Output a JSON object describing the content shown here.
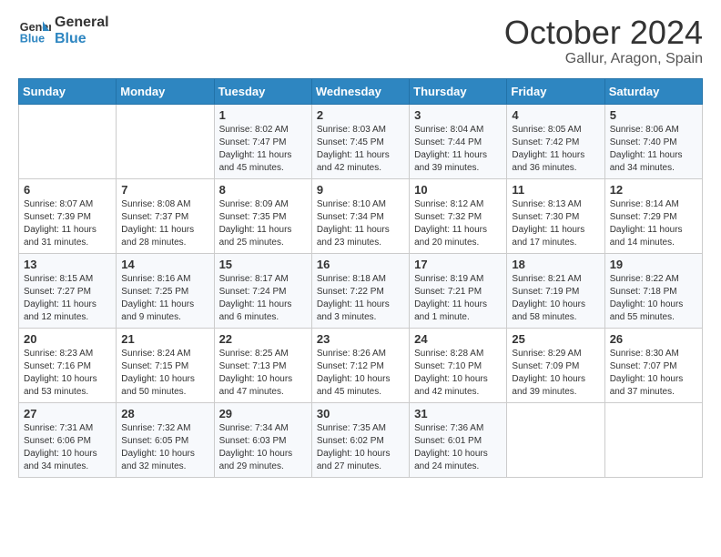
{
  "header": {
    "logo_line1": "General",
    "logo_line2": "Blue",
    "month": "October 2024",
    "location": "Gallur, Aragon, Spain"
  },
  "weekdays": [
    "Sunday",
    "Monday",
    "Tuesday",
    "Wednesday",
    "Thursday",
    "Friday",
    "Saturday"
  ],
  "weeks": [
    [
      null,
      null,
      {
        "day": 1,
        "sunrise": "8:02 AM",
        "sunset": "7:47 PM",
        "daylight": "11 hours and 45 minutes."
      },
      {
        "day": 2,
        "sunrise": "8:03 AM",
        "sunset": "7:45 PM",
        "daylight": "11 hours and 42 minutes."
      },
      {
        "day": 3,
        "sunrise": "8:04 AM",
        "sunset": "7:44 PM",
        "daylight": "11 hours and 39 minutes."
      },
      {
        "day": 4,
        "sunrise": "8:05 AM",
        "sunset": "7:42 PM",
        "daylight": "11 hours and 36 minutes."
      },
      {
        "day": 5,
        "sunrise": "8:06 AM",
        "sunset": "7:40 PM",
        "daylight": "11 hours and 34 minutes."
      }
    ],
    [
      {
        "day": 6,
        "sunrise": "8:07 AM",
        "sunset": "7:39 PM",
        "daylight": "11 hours and 31 minutes."
      },
      {
        "day": 7,
        "sunrise": "8:08 AM",
        "sunset": "7:37 PM",
        "daylight": "11 hours and 28 minutes."
      },
      {
        "day": 8,
        "sunrise": "8:09 AM",
        "sunset": "7:35 PM",
        "daylight": "11 hours and 25 minutes."
      },
      {
        "day": 9,
        "sunrise": "8:10 AM",
        "sunset": "7:34 PM",
        "daylight": "11 hours and 23 minutes."
      },
      {
        "day": 10,
        "sunrise": "8:12 AM",
        "sunset": "7:32 PM",
        "daylight": "11 hours and 20 minutes."
      },
      {
        "day": 11,
        "sunrise": "8:13 AM",
        "sunset": "7:30 PM",
        "daylight": "11 hours and 17 minutes."
      },
      {
        "day": 12,
        "sunrise": "8:14 AM",
        "sunset": "7:29 PM",
        "daylight": "11 hours and 14 minutes."
      }
    ],
    [
      {
        "day": 13,
        "sunrise": "8:15 AM",
        "sunset": "7:27 PM",
        "daylight": "11 hours and 12 minutes."
      },
      {
        "day": 14,
        "sunrise": "8:16 AM",
        "sunset": "7:25 PM",
        "daylight": "11 hours and 9 minutes."
      },
      {
        "day": 15,
        "sunrise": "8:17 AM",
        "sunset": "7:24 PM",
        "daylight": "11 hours and 6 minutes."
      },
      {
        "day": 16,
        "sunrise": "8:18 AM",
        "sunset": "7:22 PM",
        "daylight": "11 hours and 3 minutes."
      },
      {
        "day": 17,
        "sunrise": "8:19 AM",
        "sunset": "7:21 PM",
        "daylight": "11 hours and 1 minute."
      },
      {
        "day": 18,
        "sunrise": "8:21 AM",
        "sunset": "7:19 PM",
        "daylight": "10 hours and 58 minutes."
      },
      {
        "day": 19,
        "sunrise": "8:22 AM",
        "sunset": "7:18 PM",
        "daylight": "10 hours and 55 minutes."
      }
    ],
    [
      {
        "day": 20,
        "sunrise": "8:23 AM",
        "sunset": "7:16 PM",
        "daylight": "10 hours and 53 minutes."
      },
      {
        "day": 21,
        "sunrise": "8:24 AM",
        "sunset": "7:15 PM",
        "daylight": "10 hours and 50 minutes."
      },
      {
        "day": 22,
        "sunrise": "8:25 AM",
        "sunset": "7:13 PM",
        "daylight": "10 hours and 47 minutes."
      },
      {
        "day": 23,
        "sunrise": "8:26 AM",
        "sunset": "7:12 PM",
        "daylight": "10 hours and 45 minutes."
      },
      {
        "day": 24,
        "sunrise": "8:28 AM",
        "sunset": "7:10 PM",
        "daylight": "10 hours and 42 minutes."
      },
      {
        "day": 25,
        "sunrise": "8:29 AM",
        "sunset": "7:09 PM",
        "daylight": "10 hours and 39 minutes."
      },
      {
        "day": 26,
        "sunrise": "8:30 AM",
        "sunset": "7:07 PM",
        "daylight": "10 hours and 37 minutes."
      }
    ],
    [
      {
        "day": 27,
        "sunrise": "7:31 AM",
        "sunset": "6:06 PM",
        "daylight": "10 hours and 34 minutes."
      },
      {
        "day": 28,
        "sunrise": "7:32 AM",
        "sunset": "6:05 PM",
        "daylight": "10 hours and 32 minutes."
      },
      {
        "day": 29,
        "sunrise": "7:34 AM",
        "sunset": "6:03 PM",
        "daylight": "10 hours and 29 minutes."
      },
      {
        "day": 30,
        "sunrise": "7:35 AM",
        "sunset": "6:02 PM",
        "daylight": "10 hours and 27 minutes."
      },
      {
        "day": 31,
        "sunrise": "7:36 AM",
        "sunset": "6:01 PM",
        "daylight": "10 hours and 24 minutes."
      },
      null,
      null
    ]
  ],
  "labels": {
    "sunrise": "Sunrise:",
    "sunset": "Sunset:",
    "daylight": "Daylight:"
  }
}
